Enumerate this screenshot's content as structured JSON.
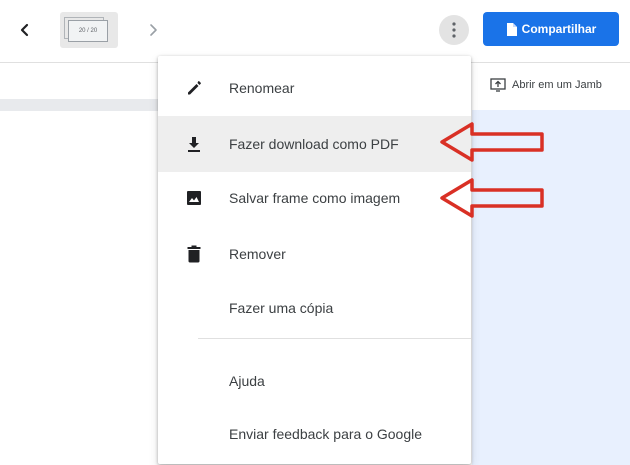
{
  "toolbar": {
    "frame_counter": "20 / 20",
    "share_label": "Compartilhar",
    "open_label": "Abrir em um Jamb"
  },
  "menu": {
    "items": [
      {
        "label": "Renomear",
        "icon": "pencil-icon"
      },
      {
        "label": "Fazer download como PDF",
        "icon": "download-icon"
      },
      {
        "label": "Salvar frame como imagem",
        "icon": "image-icon"
      },
      {
        "label": "Remover",
        "icon": "trash-icon"
      },
      {
        "label": "Fazer uma cópia",
        "icon": ""
      },
      {
        "label": "Ajuda",
        "icon": ""
      },
      {
        "label": "Enviar feedback para o Google",
        "icon": ""
      }
    ]
  },
  "colors": {
    "accent": "#1a73e8",
    "annotation": "#d93025",
    "panel": "#e8f0fe"
  }
}
